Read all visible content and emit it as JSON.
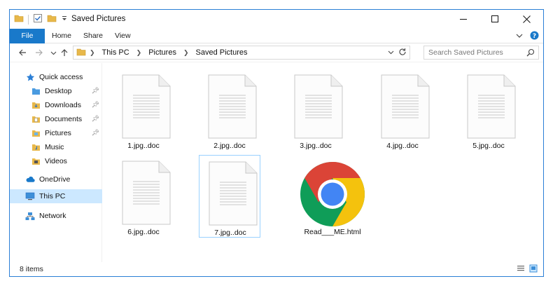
{
  "window": {
    "title": "Saved Pictures"
  },
  "ribbon": {
    "tabs": [
      "File",
      "Home",
      "Share",
      "View"
    ]
  },
  "address": {
    "crumbs": [
      "This PC",
      "Pictures",
      "Saved Pictures"
    ],
    "search_placeholder": "Search Saved Pictures"
  },
  "sidebar": {
    "items": [
      {
        "label": "Quick access",
        "icon": "star-icon"
      },
      {
        "label": "Desktop",
        "icon": "folder-icon",
        "pinned": true
      },
      {
        "label": "Downloads",
        "icon": "downloads-folder-icon",
        "pinned": true
      },
      {
        "label": "Documents",
        "icon": "documents-folder-icon",
        "pinned": true
      },
      {
        "label": "Pictures",
        "icon": "pictures-folder-icon",
        "pinned": true
      },
      {
        "label": "Music",
        "icon": "music-folder-icon"
      },
      {
        "label": "Videos",
        "icon": "videos-folder-icon"
      },
      {
        "label": "OneDrive",
        "icon": "cloud-icon"
      },
      {
        "label": "This PC",
        "icon": "computer-icon",
        "selected": true
      },
      {
        "label": "Network",
        "icon": "network-icon"
      }
    ]
  },
  "files": [
    {
      "name": "1.jpg..doc",
      "type": "doc"
    },
    {
      "name": "2.jpg..doc",
      "type": "doc"
    },
    {
      "name": "3.jpg..doc",
      "type": "doc"
    },
    {
      "name": "4.jpg..doc",
      "type": "doc"
    },
    {
      "name": "5.jpg..doc",
      "type": "doc"
    },
    {
      "name": "6.jpg..doc",
      "type": "doc"
    },
    {
      "name": "7.jpg..doc",
      "type": "doc",
      "focused": true
    },
    {
      "name": "Read___ME.html",
      "type": "chrome-html"
    }
  ],
  "status": {
    "item_count": "8 items"
  },
  "colors": {
    "accent": "#1979ca",
    "selection": "#cce8ff",
    "chrome_red": "#db4437",
    "chrome_yellow": "#f4c20d",
    "chrome_green": "#0f9d58",
    "chrome_blue": "#4285f4"
  }
}
